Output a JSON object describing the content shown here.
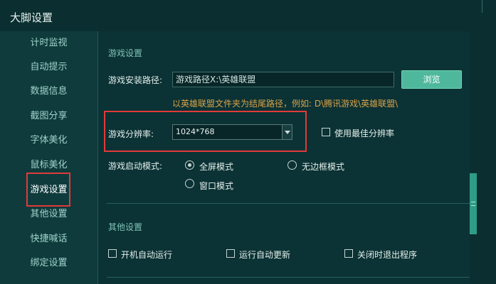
{
  "window": {
    "title": "大脚设置"
  },
  "sidebar": {
    "items": [
      {
        "label": "计时监视",
        "active": false
      },
      {
        "label": "自动提示",
        "active": false
      },
      {
        "label": "数据信息",
        "active": false
      },
      {
        "label": "截图分享",
        "active": false
      },
      {
        "label": "字体美化",
        "active": false
      },
      {
        "label": "鼠标美化",
        "active": false
      },
      {
        "label": "游戏设置",
        "active": true
      },
      {
        "label": "其他设置",
        "active": false
      },
      {
        "label": "快捷喊话",
        "active": false
      },
      {
        "label": "绑定设置",
        "active": false
      }
    ]
  },
  "game_settings": {
    "section_title": "游戏设置",
    "install_path_label": "游戏安装路径:",
    "install_path_value": "游戏路径X:\\英雄联盟",
    "browse_label": "浏览",
    "path_hint": "以英雄联盟文件夹为结尾路径，例如: D\\腾讯游戏\\英雄联盟\\",
    "resolution_label": "游戏分辨率:",
    "resolution_value": "1024*768",
    "best_resolution_label": "使用最佳分辨率",
    "best_resolution_checked": false,
    "launch_mode_label": "游戏启动模式:",
    "launch_modes": [
      {
        "label": "全屏模式",
        "checked": true
      },
      {
        "label": "无边框模式",
        "checked": false
      },
      {
        "label": "窗口模式",
        "checked": false
      }
    ]
  },
  "other_settings": {
    "section_title": "其他设置",
    "options": [
      {
        "label": "开机自动运行",
        "checked": false
      },
      {
        "label": "运行自动更新",
        "checked": false
      },
      {
        "label": "关闭时退出程序",
        "checked": false
      }
    ]
  },
  "colors": {
    "background": "#0f3b3d",
    "panel": "#0b3234",
    "accent": "#4fb89c",
    "hint": "#d9a24a",
    "highlight": "#e13a3a"
  }
}
